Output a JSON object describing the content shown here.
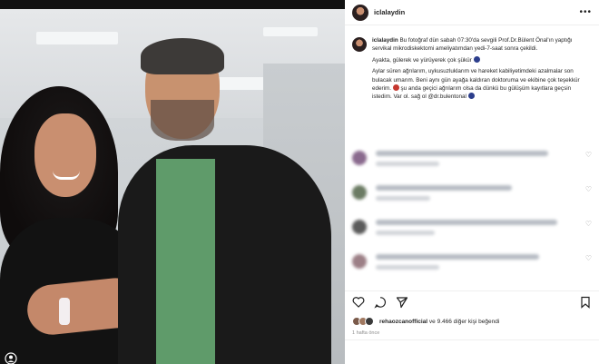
{
  "post": {
    "username": "iclalaydin",
    "more_icon": "more-horizontal-icon",
    "caption": {
      "username": "iclalaydin",
      "p1": "Bu fotoğraf dün sabah 07:30'da sevgili Prof.Dr.Bülent Önal'ın yaptığı servikal mikrodiskektomi ameliyatımdan yedi-7-saat sonra çekildi.",
      "p2": "Ayakta, gülerek ve yürüyerek çok şükür",
      "p3": "Aylar süren ağrılarım, uykusuzluklarım ve hareket kabiliyetimdeki azalmalar son bulacak umarım. Beni aynı gün ayağa kaldıran doktoruma ve ekibine çok teşekkür ederim.",
      "p3b": "şu anda geçici ağrılarım olsa da dünkü bu gülüşüm kayıtlara geçsin istedim. Var ol. sağ ol @dr.bulentonal"
    },
    "likes": {
      "first_user": "rehaozcanofficial",
      "rest": "ve 9.466 diğer kişi beğendi"
    },
    "time": "1 hafta önce"
  },
  "icons": {
    "like": "heart-icon",
    "comment": "comment-icon",
    "share": "send-icon",
    "save": "bookmark-icon"
  },
  "colors": {
    "scrubs": "#5f9b6a",
    "emoji_blue": "#2c3e8c",
    "emoji_red": "#c5372f"
  }
}
